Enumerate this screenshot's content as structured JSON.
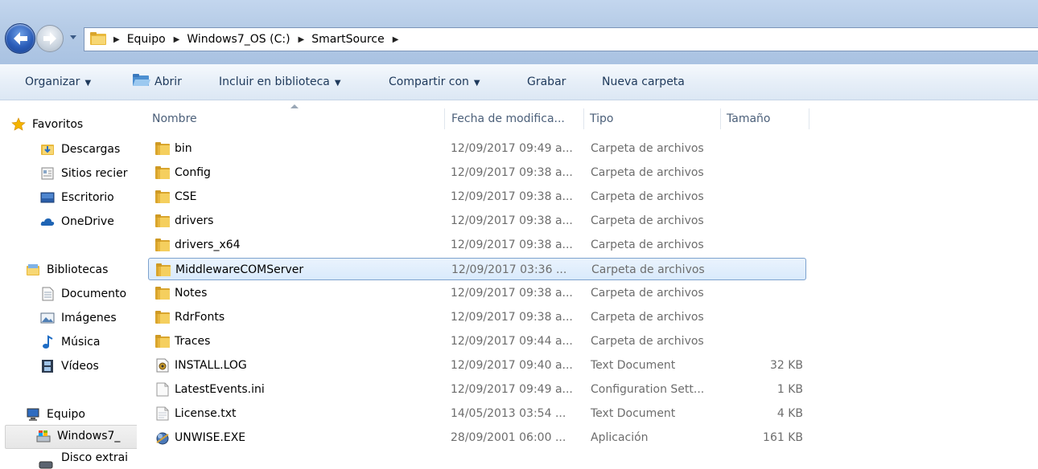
{
  "address": {
    "crumbs": [
      "Equipo",
      "Windows7_OS (C:)",
      "SmartSource"
    ],
    "separator": "▶"
  },
  "toolbar": {
    "organize": "Organizar",
    "open": "Abrir",
    "include_library": "Incluir en biblioteca",
    "share_with": "Compartir con",
    "burn": "Grabar",
    "new_folder": "Nueva carpeta",
    "dropdown_arrow": "▼"
  },
  "nav": {
    "favorites": "Favoritos",
    "downloads": "Descargas",
    "recent_sites": "Sitios recier",
    "desktop": "Escritorio",
    "onedrive": "OneDrive",
    "libraries": "Bibliotecas",
    "documents": "Documento",
    "images": "Imágenes",
    "music": "Música",
    "videos": "Vídeos",
    "computer": "Equipo",
    "windows_drive": "Windows7_",
    "external_disk": "Disco extrai"
  },
  "columns": {
    "name": "Nombre",
    "date": "Fecha de modifica...",
    "type": "Tipo",
    "size": "Tamaño"
  },
  "files": [
    {
      "name": "bin",
      "date": "12/09/2017 09:49 a...",
      "type": "Carpeta de archivos",
      "size": "",
      "icon": "folder-icon"
    },
    {
      "name": "Config",
      "date": "12/09/2017 09:38 a...",
      "type": "Carpeta de archivos",
      "size": "",
      "icon": "folder-icon"
    },
    {
      "name": "CSE",
      "date": "12/09/2017 09:38 a...",
      "type": "Carpeta de archivos",
      "size": "",
      "icon": "folder-icon"
    },
    {
      "name": "drivers",
      "date": "12/09/2017 09:38 a...",
      "type": "Carpeta de archivos",
      "size": "",
      "icon": "folder-icon"
    },
    {
      "name": "drivers_x64",
      "date": "12/09/2017 09:38 a...",
      "type": "Carpeta de archivos",
      "size": "",
      "icon": "folder-icon"
    },
    {
      "name": "MiddlewareCOMServer",
      "date": "12/09/2017 03:36 ...",
      "type": "Carpeta de archivos",
      "size": "",
      "icon": "folder-icon",
      "selected": true
    },
    {
      "name": "Notes",
      "date": "12/09/2017 09:38 a...",
      "type": "Carpeta de archivos",
      "size": "",
      "icon": "folder-icon"
    },
    {
      "name": "RdrFonts",
      "date": "12/09/2017 09:38 a...",
      "type": "Carpeta de archivos",
      "size": "",
      "icon": "folder-icon"
    },
    {
      "name": "Traces",
      "date": "12/09/2017 09:44 a...",
      "type": "Carpeta de archivos",
      "size": "",
      "icon": "folder-icon"
    },
    {
      "name": "INSTALL.LOG",
      "date": "12/09/2017 09:40 a...",
      "type": "Text Document",
      "size": "32 KB",
      "icon": "log-file-icon"
    },
    {
      "name": "LatestEvents.ini",
      "date": "12/09/2017 09:49 a...",
      "type": "Configuration Sett...",
      "size": "1 KB",
      "icon": "ini-file-icon"
    },
    {
      "name": "License.txt",
      "date": "14/05/2013 03:54 ...",
      "type": "Text Document",
      "size": "4 KB",
      "icon": "text-file-icon"
    },
    {
      "name": "UNWISE.EXE",
      "date": "28/09/2001 06:00 ...",
      "type": "Aplicación",
      "size": "161 KB",
      "icon": "exe-file-icon"
    }
  ],
  "colors": {
    "folder": "#f1c64a",
    "selection_border": "#7da2ce",
    "selection_fill": "#dcebfc",
    "toolbar_text": "#1e395b"
  }
}
